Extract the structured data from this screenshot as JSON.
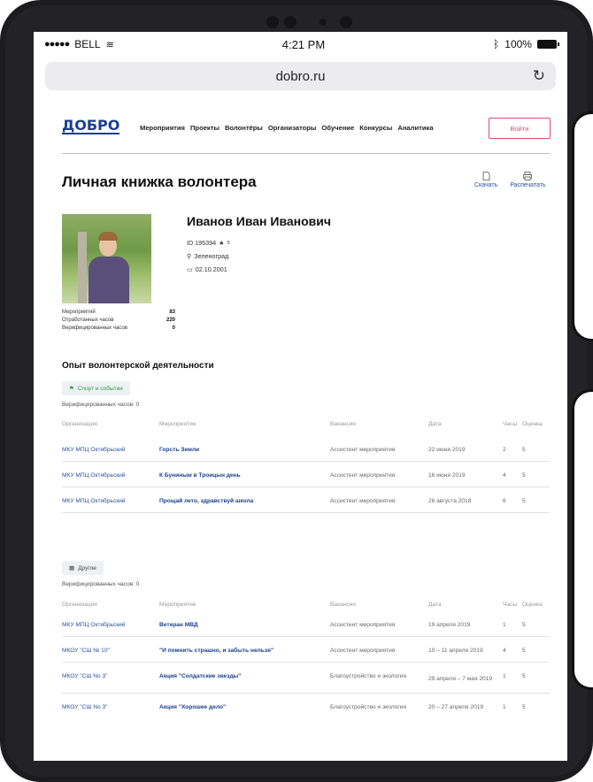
{
  "status": {
    "carrier": "BELL",
    "time": "4:21 PM",
    "battery": "100%"
  },
  "browser": {
    "url": "dobro.ru"
  },
  "nav": {
    "logo": "ДОБРО",
    "items": [
      "Мероприятия",
      "Проекты",
      "Волонтёры",
      "Организаторы",
      "Обучение",
      "Конкурсы",
      "Аналитика"
    ],
    "login": "Войти"
  },
  "page": {
    "title": "Личная книжка волонтера",
    "download": "Скачать",
    "print": "Распечатать"
  },
  "profile": {
    "name": "Иванов Иван Иванович",
    "id": "ID 195394",
    "rating": "5",
    "city": "Зеленоград",
    "birthdate": "02.10.2001",
    "stats": [
      {
        "label": "Мероприятий",
        "value": "83"
      },
      {
        "label": "Отработанных часов",
        "value": "220"
      },
      {
        "label": "Верифицированных часов",
        "value": "0"
      }
    ]
  },
  "experience": {
    "title": "Опыт волонтерской деятельности",
    "columns": [
      "Организация",
      "Мероприятие",
      "Вакансия",
      "Дата",
      "Часы",
      "Оценка"
    ],
    "groups": [
      {
        "tag": "Спорт и события",
        "verified": "Верифицированных часов: 0",
        "rows": [
          {
            "org": "МКУ МПЦ Октябрьский",
            "event": "Горсть Земли",
            "vacancy": "Ассистент мероприятия",
            "date": "22 июня 2019",
            "hours": "2",
            "score": "5"
          },
          {
            "org": "МКУ МПЦ Октябрьский",
            "event": "К Буниным в Троицын день",
            "vacancy": "Ассистент мероприятия",
            "date": "16 июня 2019",
            "hours": "4",
            "score": "5"
          },
          {
            "org": "МКУ МПЦ Октябрьский",
            "event": "Прощай лето, здравствуй школа",
            "vacancy": "Ассистент мероприятия",
            "date": "26 августа 2018",
            "hours": "6",
            "score": "5"
          }
        ]
      },
      {
        "tag": "Другое",
        "verified": "Верифицированных часов: 0",
        "rows": [
          {
            "org": "МКУ МПЦ Октябрьский",
            "event": "Ветеран МВД",
            "vacancy": "Ассистент мероприятия",
            "date": "19 апреля 2019",
            "hours": "1",
            "score": "5"
          },
          {
            "org": "МКОУ \"СШ № 10\"",
            "event": "\"И помнить страшно, и забыть нельзя\"",
            "vacancy": "Ассистент мероприятия",
            "date": "10 – 11 апреля 2019",
            "hours": "4",
            "score": "5"
          },
          {
            "org": "МКОУ \"СШ No 3\"",
            "event": "Акция \"Солдатские звезды\"",
            "vacancy": "Благоустройство и экология",
            "date": "29 апреля – 7 мая 2019",
            "hours": "1",
            "score": "5"
          },
          {
            "org": "МКОУ \"СШ No 3\"",
            "event": "Акция \"Хорошее дело\"",
            "vacancy": "Благоустройство и экология",
            "date": "20 – 27 апреля 2019",
            "hours": "1",
            "score": "5"
          }
        ]
      }
    ]
  }
}
